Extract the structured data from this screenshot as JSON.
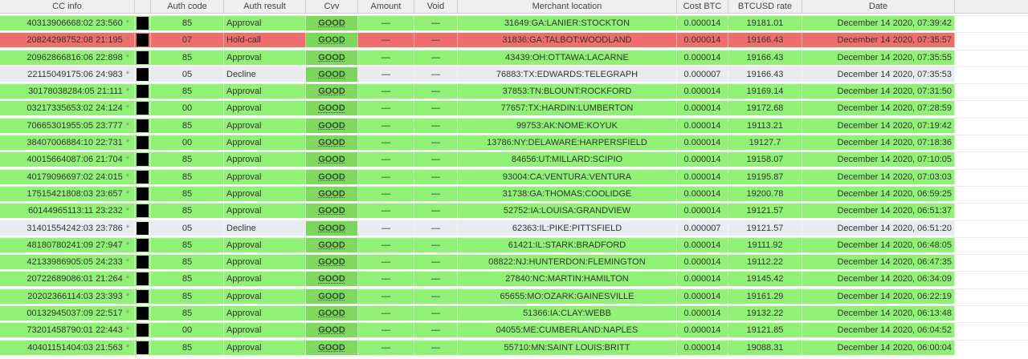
{
  "columns": {
    "cc_info": "CC info",
    "auth_code": "Auth code",
    "auth_result": "Auth result",
    "cvv": "Cvv",
    "amount": "Amount",
    "void": "Void",
    "merchant_location": "Merchant location",
    "cost_btc": "Cost BTC",
    "btcusd_rate": "BTCUSD rate",
    "date": "Date"
  },
  "colors": {
    "approval": "#90f274",
    "hold_call": "#ee6f6a",
    "decline": "#e8ebef",
    "cvv_good": "#7fd95e"
  },
  "rows": [
    {
      "cc": "40313906668:02 23:560",
      "star": "*",
      "auth_code": "85",
      "auth_result": "Approval",
      "status": "approval",
      "cvv": "GOOD",
      "amount": "—",
      "void": "—",
      "merchant": "31649:GA:LANIER:STOCKTON",
      "cost": "0.000014",
      "rate": "19181.01",
      "date": "December 14 2020, 07:39:42"
    },
    {
      "cc": "20824298752:08 21:195",
      "star": "*",
      "auth_code": "07",
      "auth_result": "Hold-call",
      "status": "hold",
      "cvv": "GOOD",
      "amount": "—",
      "void": "—",
      "merchant": "31836:GA:TALBOT:WOODLAND",
      "cost": "0.000014",
      "rate": "19166.43",
      "date": "December 14 2020, 07:35:57"
    },
    {
      "cc": "20962866816:06 22:898",
      "star": "*",
      "auth_code": "85",
      "auth_result": "Approval",
      "status": "approval",
      "cvv": "GOOD",
      "amount": "—",
      "void": "—",
      "merchant": "43439:OH:OTTAWA:LACARNE",
      "cost": "0.000014",
      "rate": "19166.43",
      "date": "December 14 2020, 07:35:55"
    },
    {
      "cc": "22115049175:06 24:983",
      "star": "*",
      "auth_code": "05",
      "auth_result": "Decline",
      "status": "decline",
      "cvv": "GOOD",
      "amount": "—",
      "void": "—",
      "merchant": "76883:TX:EDWARDS:TELEGRAPH",
      "cost": "0.000007",
      "rate": "19166.43",
      "date": "December 14 2020, 07:35:53"
    },
    {
      "cc": "30178038284:05 21:111",
      "star": "*",
      "auth_code": "85",
      "auth_result": "Approval",
      "status": "approval",
      "cvv": "GOOD",
      "amount": "—",
      "void": "—",
      "merchant": "37853:TN:BLOUNT:ROCKFORD",
      "cost": "0.000014",
      "rate": "19169.14",
      "date": "December 14 2020, 07:31:50"
    },
    {
      "cc": "03217335653:02 24:124",
      "star": "*",
      "auth_code": "00",
      "auth_result": "Approval",
      "status": "approval",
      "cvv": "GOOD",
      "amount": "—",
      "void": "—",
      "merchant": "77657:TX:HARDIN:LUMBERTON",
      "cost": "0.000014",
      "rate": "19172.68",
      "date": "December 14 2020, 07:28:59"
    },
    {
      "cc": "70665301955:05 23:777",
      "star": "*",
      "auth_code": "85",
      "auth_result": "Approval",
      "status": "approval",
      "cvv": "GOOD",
      "amount": "—",
      "void": "—",
      "merchant": "99753:AK:NOME:KOYUK",
      "cost": "0.000014",
      "rate": "19113.21",
      "date": "December 14 2020, 07:19:42"
    },
    {
      "cc": "38407006884:10 22:731",
      "star": "*",
      "auth_code": "00",
      "auth_result": "Approval",
      "status": "approval",
      "cvv": "GOOD",
      "amount": "—",
      "void": "—",
      "merchant": "13786:NY:DELAWARE:HARPERSFIELD",
      "cost": "0.000014",
      "rate": "19127.7",
      "date": "December 14 2020, 07:18:36"
    },
    {
      "cc": "40015664087:06 21:704",
      "star": "*",
      "auth_code": "85",
      "auth_result": "Approval",
      "status": "approval",
      "cvv": "GOOD",
      "amount": "—",
      "void": "—",
      "merchant": "84656:UT:MILLARD:SCIPIO",
      "cost": "0.000014",
      "rate": "19158.07",
      "date": "December 14 2020, 07:10:05"
    },
    {
      "cc": "40179096697:02 24:015",
      "star": "*",
      "auth_code": "85",
      "auth_result": "Approval",
      "status": "approval",
      "cvv": "GOOD",
      "amount": "—",
      "void": "—",
      "merchant": "93004:CA:VENTURA:VENTURA",
      "cost": "0.000014",
      "rate": "19195.87",
      "date": "December 14 2020, 07:03:03"
    },
    {
      "cc": "17515421808:03 23:657",
      "star": "*",
      "auth_code": "85",
      "auth_result": "Approval",
      "status": "approval",
      "cvv": "GOOD",
      "amount": "—",
      "void": "—",
      "merchant": "31738:GA:THOMAS:COOLIDGE",
      "cost": "0.000014",
      "rate": "19200.78",
      "date": "December 14 2020, 06:59:25"
    },
    {
      "cc": "60144965113:11 23:232",
      "star": "*",
      "auth_code": "85",
      "auth_result": "Approval",
      "status": "approval",
      "cvv": "GOOD",
      "amount": "—",
      "void": "—",
      "merchant": "52752:IA:LOUISA:GRANDVIEW",
      "cost": "0.000014",
      "rate": "19121.57",
      "date": "December 14 2020, 06:51:37"
    },
    {
      "cc": "31401554242:03 23:786",
      "star": "*",
      "auth_code": "05",
      "auth_result": "Decline",
      "status": "decline",
      "cvv": "GOOD",
      "amount": "—",
      "void": "—",
      "merchant": "62363:IL:PIKE:PITTSFIELD",
      "cost": "0.000007",
      "rate": "19121.57",
      "date": "December 14 2020, 06:51:20"
    },
    {
      "cc": "48180780241:09 27:947",
      "star": "*",
      "auth_code": "85",
      "auth_result": "Approval",
      "status": "approval",
      "cvv": "GOOD",
      "amount": "—",
      "void": "—",
      "merchant": "61421:IL:STARK:BRADFORD",
      "cost": "0.000014",
      "rate": "19111.92",
      "date": "December 14 2020, 06:48:05"
    },
    {
      "cc": "42133986905:05 24:233",
      "star": "*",
      "auth_code": "85",
      "auth_result": "Approval",
      "status": "approval",
      "cvv": "GOOD",
      "amount": "—",
      "void": "—",
      "merchant": "08822:NJ:HUNTERDON:FLEMINGTON",
      "cost": "0.000014",
      "rate": "19112.22",
      "date": "December 14 2020, 06:47:35"
    },
    {
      "cc": "20722689086:01 21:264",
      "star": "*",
      "auth_code": "85",
      "auth_result": "Approval",
      "status": "approval",
      "cvv": "GOOD",
      "amount": "—",
      "void": "—",
      "merchant": "27840:NC:MARTIN:HAMILTON",
      "cost": "0.000014",
      "rate": "19145.42",
      "date": "December 14 2020, 06:34:09"
    },
    {
      "cc": "20202366114:03 23:393",
      "star": "*",
      "auth_code": "85",
      "auth_result": "Approval",
      "status": "approval",
      "cvv": "GOOD",
      "amount": "—",
      "void": "—",
      "merchant": "65655:MO:OZARK:GAINESVILLE",
      "cost": "0.000014",
      "rate": "19161.29",
      "date": "December 14 2020, 06:22:19"
    },
    {
      "cc": "00132945037:09 22:517",
      "star": "*",
      "auth_code": "85",
      "auth_result": "Approval",
      "status": "approval",
      "cvv": "GOOD",
      "amount": "—",
      "void": "—",
      "merchant": "51366:IA:CLAY:WEBB",
      "cost": "0.000014",
      "rate": "19132.22",
      "date": "December 14 2020, 06:13:48"
    },
    {
      "cc": "73201458790:01 22:443",
      "star": "*",
      "auth_code": "00",
      "auth_result": "Approval",
      "status": "approval",
      "cvv": "GOOD",
      "amount": "—",
      "void": "—",
      "merchant": "04055:ME:CUMBERLAND:NAPLES",
      "cost": "0.000014",
      "rate": "19121.85",
      "date": "December 14 2020, 06:04:52"
    },
    {
      "cc": "40401151404:03 21:563",
      "star": "*",
      "auth_code": "85",
      "auth_result": "Approval",
      "status": "approval",
      "cvv": "GOOD",
      "amount": "—",
      "void": "—",
      "merchant": "55710:MN:SAINT LOUIS:BRITT",
      "cost": "0.000014",
      "rate": "19088.31",
      "date": "December 14 2020, 06:00:04"
    }
  ]
}
